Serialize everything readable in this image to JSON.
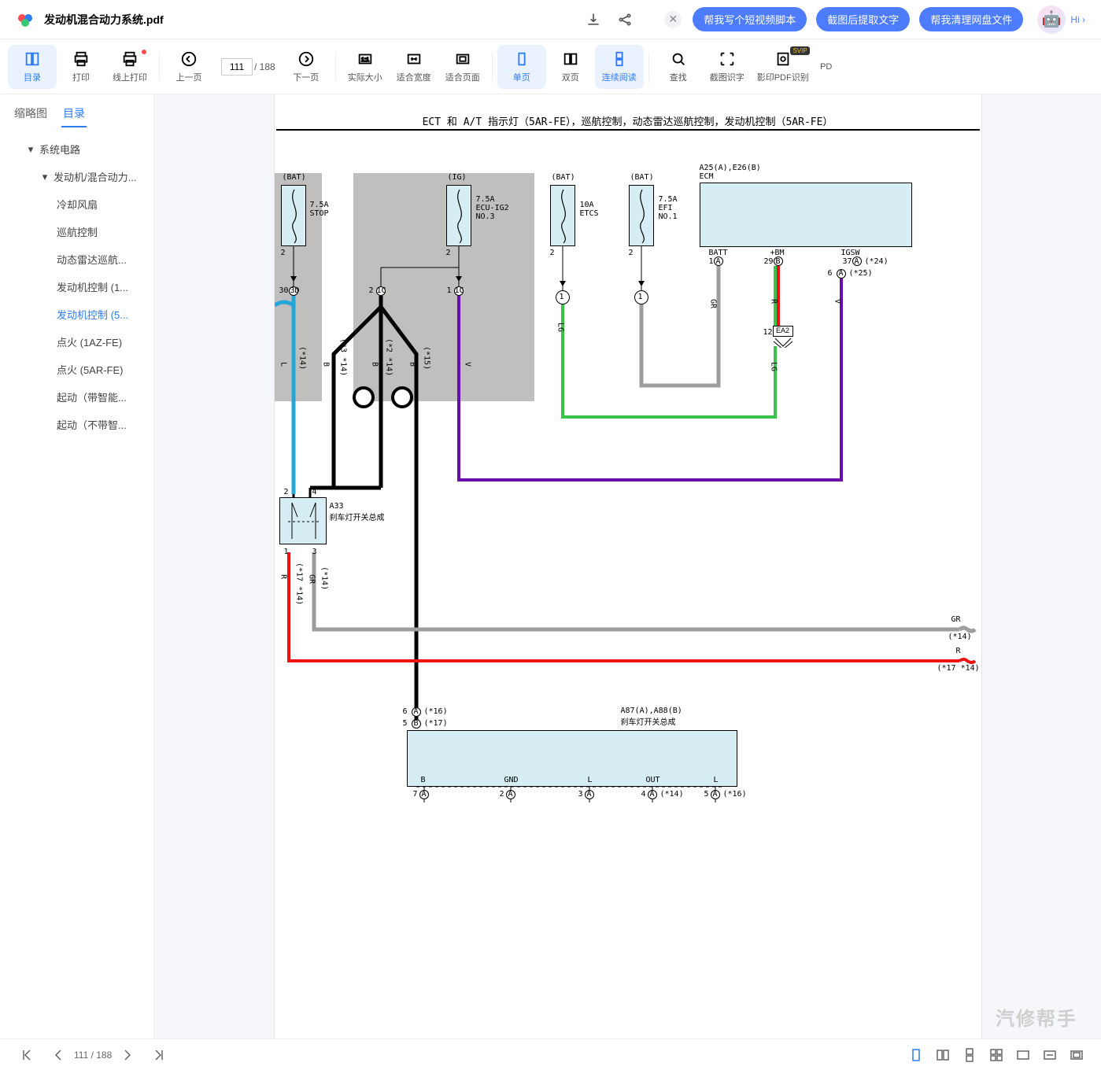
{
  "titlebar": {
    "doc_name": "发动机混合动力系统.pdf",
    "pills": [
      "帮我写个短视频脚本",
      "截图后提取文字",
      "帮我清理网盘文件"
    ],
    "hi": "Hi ›"
  },
  "toolbar": {
    "catalog": "目录",
    "print": "打印",
    "online_print": "线上打印",
    "prev": "上一页",
    "page_current": "111",
    "page_total": "/ 188",
    "next": "下一页",
    "actual_size": "实际大小",
    "fit_width": "适合宽度",
    "fit_page": "适合页面",
    "single": "单页",
    "double": "双页",
    "continuous": "连续阅读",
    "search": "查找",
    "ocr_crop": "截图识字",
    "ocr_pdf": "影印PDF识别",
    "pdf_last": "PD",
    "svip": "SVIP"
  },
  "sidebar": {
    "tab_thumb": "缩略图",
    "tab_outline": "目录",
    "items": [
      {
        "label": "系统电路",
        "level": 1,
        "caret": true
      },
      {
        "label": "发动机/混合动力...",
        "level": 2,
        "caret": true
      },
      {
        "label": "冷却风扇",
        "level": 3
      },
      {
        "label": "巡航控制",
        "level": 3
      },
      {
        "label": "动态雷达巡航...",
        "level": 3
      },
      {
        "label": "发动机控制 (1...",
        "level": 3
      },
      {
        "label": "发动机控制 (5...",
        "level": 3,
        "selected": true
      },
      {
        "label": "点火 (1AZ-FE)",
        "level": 3
      },
      {
        "label": "点火 (5AR-FE)",
        "level": 3
      },
      {
        "label": "起动（带智能...",
        "level": 3
      },
      {
        "label": "起动（不带智...",
        "level": 3
      }
    ]
  },
  "diagram": {
    "title": "ECT 和 A/T 指示灯（5AR-FE），巡航控制，动态雷达巡航控制，发动机控制（5AR-FE）",
    "ecm_label": "A25(A),E26(B)\nECM",
    "fuses": [
      {
        "src": "(BAT)",
        "val": "7.5A\nSTOP",
        "pin": "2"
      },
      {
        "src": "(IG)",
        "val": "7.5A\nECU-IG2\nNO.3",
        "pin": "2"
      },
      {
        "src": "(BAT)",
        "val": "10A\nETCS",
        "pin": "2"
      },
      {
        "src": "(BAT)",
        "val": "7.5A\nEFI\nNO.1",
        "pin": "2"
      }
    ],
    "ecm_pins": {
      "batt": "BATT",
      "bm": "+BM",
      "igsw": "IGSW",
      "p1": "1",
      "pA": "A",
      "p29": "29",
      "pB": "B",
      "p37": "37",
      "n24": "(*24)",
      "p6": "6",
      "n25": "(*25)"
    },
    "wire_colors": {
      "l": "L",
      "b": "B",
      "v": "V",
      "gr": "GR",
      "r": "R",
      "lg": "LG",
      "n14": "(*14)",
      "n3_14": "(*3 *14)",
      "n2_14": "(*2 *14)",
      "n15": "(*15)",
      "n17_14": "(*17 *14)"
    },
    "jb": {
      "p30": "30",
      "p3D": "3D",
      "p2": "2",
      "p1C_a": "1C",
      "p1": "1",
      "p1C_b": "1C"
    },
    "ea2": {
      "pin": "12",
      "name": "EA2"
    },
    "switch_a33": {
      "name": "A33\n刹车灯开关总成",
      "p2": "2",
      "p4": "4",
      "p1": "1",
      "p3": "3"
    },
    "mid_right": {
      "gr": "GR",
      "gr_n": "(*14)",
      "r": "R",
      "r_n": "(*17 *14)"
    },
    "lower_conn": {
      "p6": "6",
      "a6": "A",
      "n16": "(*16)",
      "p5": "5",
      "a5": "B",
      "n17": "(*17)",
      "blab": "B"
    },
    "lower_box": {
      "name": "A87(A),A88(B)\n刹车灯开关总成",
      "b": "B",
      "gnd": "GND",
      "l": "L",
      "out": "OUT",
      "l2": "L",
      "p7": "7",
      "pa": "A",
      "p2": "2",
      "p3": "3",
      "p4": "4",
      "p5": "5",
      "n14": "(*14)",
      "n16": "(*16)"
    },
    "watermark": "汽修帮手"
  },
  "bottom": {
    "page": "111 / 188"
  }
}
